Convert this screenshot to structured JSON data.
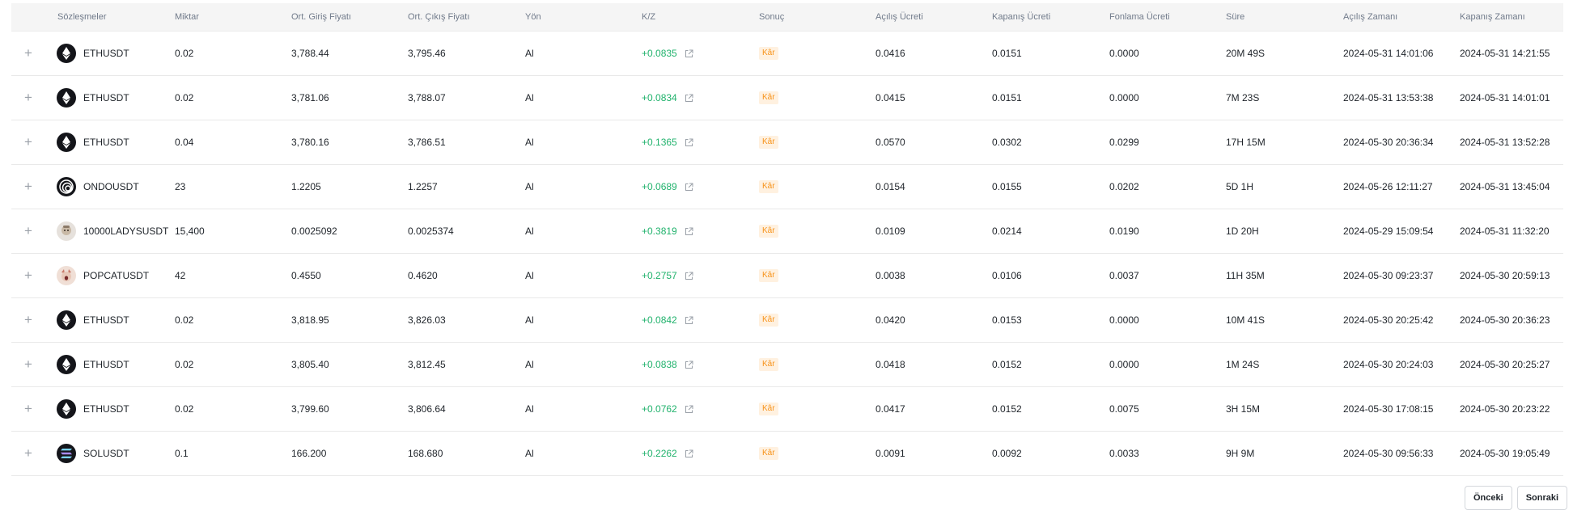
{
  "headers": {
    "contract": "Sözleşmeler",
    "amount": "Miktar",
    "entry": "Ort. Giriş Fiyatı",
    "exit": "Ort. Çıkış Fiyatı",
    "side": "Yön",
    "pnl": "K/Z",
    "result": "Sonuç",
    "open_fee": "Açılış Ücreti",
    "close_fee": "Kapanış Ücreti",
    "funding_fee": "Fonlama Ücreti",
    "duration": "Süre",
    "open_time": "Açılış Zamanı",
    "close_time": "Kapanış Zamanı"
  },
  "expand_glyph": "+",
  "rows": [
    {
      "icon": "eth-icon",
      "contract": "ETHUSDT",
      "amount": "0.02",
      "entry": "3,788.44",
      "exit": "3,795.46",
      "side": "Al",
      "pnl": "+0.0835",
      "result": "Kâr",
      "open_fee": "0.0416",
      "close_fee": "0.0151",
      "funding_fee": "0.0000",
      "duration": "20M 49S",
      "open_time": "2024-05-31 14:01:06",
      "close_time": "2024-05-31 14:21:55"
    },
    {
      "icon": "eth-icon",
      "contract": "ETHUSDT",
      "amount": "0.02",
      "entry": "3,781.06",
      "exit": "3,788.07",
      "side": "Al",
      "pnl": "+0.0834",
      "result": "Kâr",
      "open_fee": "0.0415",
      "close_fee": "0.0151",
      "funding_fee": "0.0000",
      "duration": "7M 23S",
      "open_time": "2024-05-31 13:53:38",
      "close_time": "2024-05-31 14:01:01"
    },
    {
      "icon": "eth-icon",
      "contract": "ETHUSDT",
      "amount": "0.04",
      "entry": "3,780.16",
      "exit": "3,786.51",
      "side": "Al",
      "pnl": "+0.1365",
      "result": "Kâr",
      "open_fee": "0.0570",
      "close_fee": "0.0302",
      "funding_fee": "0.0299",
      "duration": "17H 15M",
      "open_time": "2024-05-30 20:36:34",
      "close_time": "2024-05-31 13:52:28"
    },
    {
      "icon": "ondo-icon",
      "contract": "ONDOUSDT",
      "amount": "23",
      "entry": "1.2205",
      "exit": "1.2257",
      "side": "Al",
      "pnl": "+0.0689",
      "result": "Kâr",
      "open_fee": "0.0154",
      "close_fee": "0.0155",
      "funding_fee": "0.0202",
      "duration": "5D 1H",
      "open_time": "2024-05-26 12:11:27",
      "close_time": "2024-05-31 13:45:04"
    },
    {
      "icon": "lady-icon",
      "contract": "10000LADYSUSDT",
      "amount": "15,400",
      "entry": "0.0025092",
      "exit": "0.0025374",
      "side": "Al",
      "pnl": "+0.3819",
      "result": "Kâr",
      "open_fee": "0.0109",
      "close_fee": "0.0214",
      "funding_fee": "0.0190",
      "duration": "1D 20H",
      "open_time": "2024-05-29 15:09:54",
      "close_time": "2024-05-31 11:32:20"
    },
    {
      "icon": "popcat-icon",
      "contract": "POPCATUSDT",
      "amount": "42",
      "entry": "0.4550",
      "exit": "0.4620",
      "side": "Al",
      "pnl": "+0.2757",
      "result": "Kâr",
      "open_fee": "0.0038",
      "close_fee": "0.0106",
      "funding_fee": "0.0037",
      "duration": "11H 35M",
      "open_time": "2024-05-30 09:23:37",
      "close_time": "2024-05-30 20:59:13"
    },
    {
      "icon": "eth-icon",
      "contract": "ETHUSDT",
      "amount": "0.02",
      "entry": "3,818.95",
      "exit": "3,826.03",
      "side": "Al",
      "pnl": "+0.0842",
      "result": "Kâr",
      "open_fee": "0.0420",
      "close_fee": "0.0153",
      "funding_fee": "0.0000",
      "duration": "10M 41S",
      "open_time": "2024-05-30 20:25:42",
      "close_time": "2024-05-30 20:36:23"
    },
    {
      "icon": "eth-icon",
      "contract": "ETHUSDT",
      "amount": "0.02",
      "entry": "3,805.40",
      "exit": "3,812.45",
      "side": "Al",
      "pnl": "+0.0838",
      "result": "Kâr",
      "open_fee": "0.0418",
      "close_fee": "0.0152",
      "funding_fee": "0.0000",
      "duration": "1M 24S",
      "open_time": "2024-05-30 20:24:03",
      "close_time": "2024-05-30 20:25:27"
    },
    {
      "icon": "eth-icon",
      "contract": "ETHUSDT",
      "amount": "0.02",
      "entry": "3,799.60",
      "exit": "3,806.64",
      "side": "Al",
      "pnl": "+0.0762",
      "result": "Kâr",
      "open_fee": "0.0417",
      "close_fee": "0.0152",
      "funding_fee": "0.0075",
      "duration": "3H 15M",
      "open_time": "2024-05-30 17:08:15",
      "close_time": "2024-05-30 20:23:22"
    },
    {
      "icon": "sol-icon",
      "contract": "SOLUSDT",
      "amount": "0.1",
      "entry": "166.200",
      "exit": "168.680",
      "side": "Al",
      "pnl": "+0.2262",
      "result": "Kâr",
      "open_fee": "0.0091",
      "close_fee": "0.0092",
      "funding_fee": "0.0033",
      "duration": "9H 9M",
      "open_time": "2024-05-30 09:56:33",
      "close_time": "2024-05-30 19:05:49"
    }
  ],
  "pagination": {
    "prev": "Önceki",
    "next": "Sonraki"
  },
  "colors": {
    "profit": "#20b26c",
    "badge_bg": "#fff1e0",
    "badge_text": "#f7931a",
    "header_bg": "#f5f5f5"
  }
}
